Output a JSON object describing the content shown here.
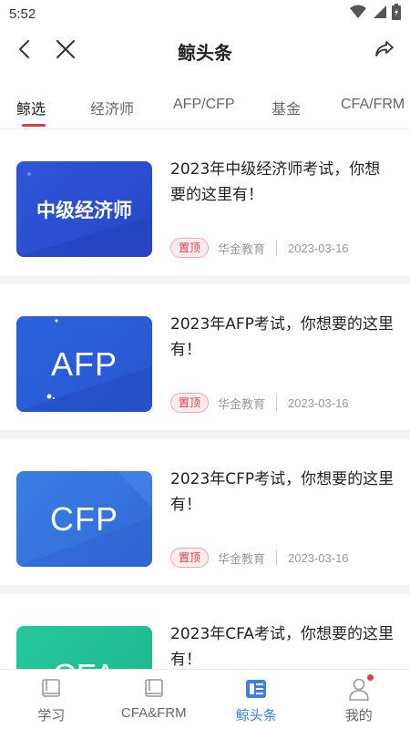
{
  "status_bar": {
    "time": "5:52",
    "icons": [
      "wifi-icon",
      "signal-icon",
      "battery-icon"
    ]
  },
  "navbar": {
    "title": "鲸头条",
    "icons": [
      "back-icon",
      "close-icon",
      "share-icon"
    ]
  },
  "tabs": [
    {
      "label": "鲸选",
      "active": true
    },
    {
      "label": "经济师",
      "active": false
    },
    {
      "label": "AFP/CFP",
      "active": false
    },
    {
      "label": "基金",
      "active": false
    },
    {
      "label": "CFA/FRM",
      "active": false
    }
  ],
  "articles": [
    {
      "thumb_text": "中级经济师",
      "title": "2023年中级经济师考试，你想要的这里有！",
      "badge": "置顶",
      "source": "华金教育",
      "date": "2023-03-16"
    },
    {
      "thumb_text": "AFP",
      "title": "2023年AFP考试，你想要的这里有！",
      "badge": "置顶",
      "source": "华金教育",
      "date": "2023-03-16"
    },
    {
      "thumb_text": "CFP",
      "title": "2023年CFP考试，你想要的这里有！",
      "badge": "置顶",
      "source": "华金教育",
      "date": "2023-03-16"
    },
    {
      "thumb_text": "CFA",
      "title": "2023年CFA考试，你想要的这里有！",
      "badge": "",
      "source": "",
      "date": ""
    }
  ],
  "bottom_nav": [
    {
      "label": "学习",
      "icon": "book-icon",
      "active": false
    },
    {
      "label": "CFA&FRM",
      "icon": "book-icon",
      "active": false
    },
    {
      "label": "鲸头条",
      "icon": "news-icon",
      "active": true
    },
    {
      "label": "我的",
      "icon": "user-icon",
      "active": false,
      "has_dot": true
    }
  ],
  "colors": {
    "accent_red": "#e23b46",
    "active_blue": "#3a7fe4"
  }
}
